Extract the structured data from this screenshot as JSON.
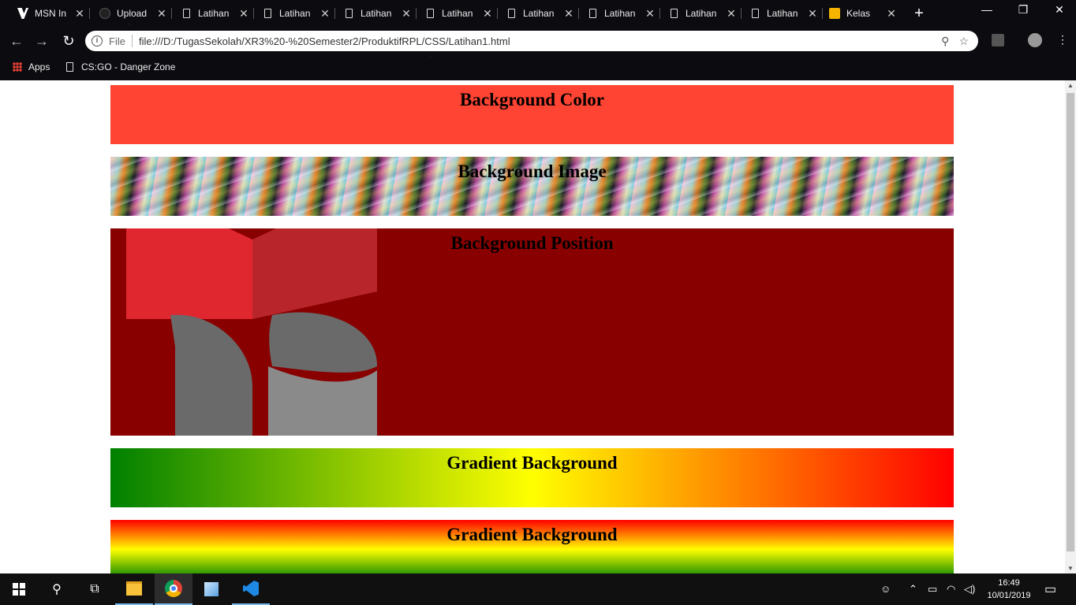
{
  "browser": {
    "tabs": [
      {
        "label": "MSN In",
        "icon": "msn-icon"
      },
      {
        "label": "Upload",
        "icon": "github-icon"
      },
      {
        "label": "Latihan",
        "icon": "page-icon"
      },
      {
        "label": "Latihan",
        "icon": "page-icon"
      },
      {
        "label": "Latihan",
        "icon": "page-icon"
      },
      {
        "label": "Latihan",
        "icon": "page-icon"
      },
      {
        "label": "Latihan",
        "icon": "page-icon"
      },
      {
        "label": "Latihan",
        "icon": "page-icon"
      },
      {
        "label": "Latihan",
        "icon": "page-icon"
      },
      {
        "label": "Latihan",
        "icon": "page-icon"
      },
      {
        "label": "Kelas",
        "icon": "classroom-icon",
        "active": true
      }
    ],
    "new_tab": "+",
    "address": {
      "scheme_label": "File",
      "url": "file:///D:/TugasSekolah/XR3%20-%20Semester2/ProduktifRPL/CSS/Latihan1.html"
    },
    "bookmarks": [
      {
        "label": "Apps",
        "icon": "apps-icon"
      },
      {
        "label": "CS:GO - Danger Zone",
        "icon": "page-icon"
      }
    ]
  },
  "page": {
    "sections": [
      {
        "heading": "Background Color",
        "color": "#ff4433"
      },
      {
        "heading": "Background Image"
      },
      {
        "heading": "Background Position",
        "color": "#880000"
      },
      {
        "heading": "Gradient Background",
        "colors": [
          "#008000",
          "#ffff00",
          "#ff0000"
        ],
        "direction": "to right"
      },
      {
        "heading": "Gradient Background",
        "colors": [
          "#ff0000",
          "#ffff00",
          "#008000"
        ],
        "direction": "to bottom"
      }
    ]
  },
  "taskbar": {
    "time": "16:49",
    "date": "10/01/2019"
  }
}
